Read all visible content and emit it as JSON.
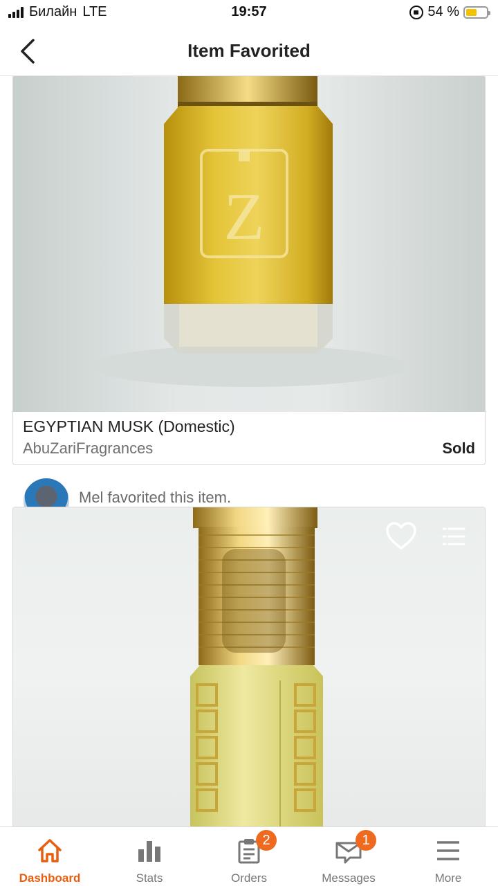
{
  "status_bar": {
    "carrier": "Билайн",
    "network": "LTE",
    "time": "19:57",
    "battery": "54 %",
    "battery_level": 0.54
  },
  "header": {
    "title": "Item Favorited",
    "back_icon": "chevron-left-icon"
  },
  "items": [
    {
      "title": "EGYPTIAN MUSK (Domestic)",
      "shop": "AbuZariFragrances",
      "status": "Sold"
    }
  ],
  "activity": {
    "text": "Mel favorited this item."
  },
  "tabs": [
    {
      "label": "Dashboard",
      "icon": "house-icon",
      "active": true
    },
    {
      "label": "Stats",
      "icon": "bar-chart-icon"
    },
    {
      "label": "Orders",
      "icon": "clipboard-icon",
      "badge": "2"
    },
    {
      "label": "Messages",
      "icon": "envelope-icon",
      "badge": "1"
    },
    {
      "label": "More",
      "icon": "menu-icon"
    }
  ],
  "colors": {
    "accent": "#e8600f",
    "badge": "#ef6a1f"
  }
}
